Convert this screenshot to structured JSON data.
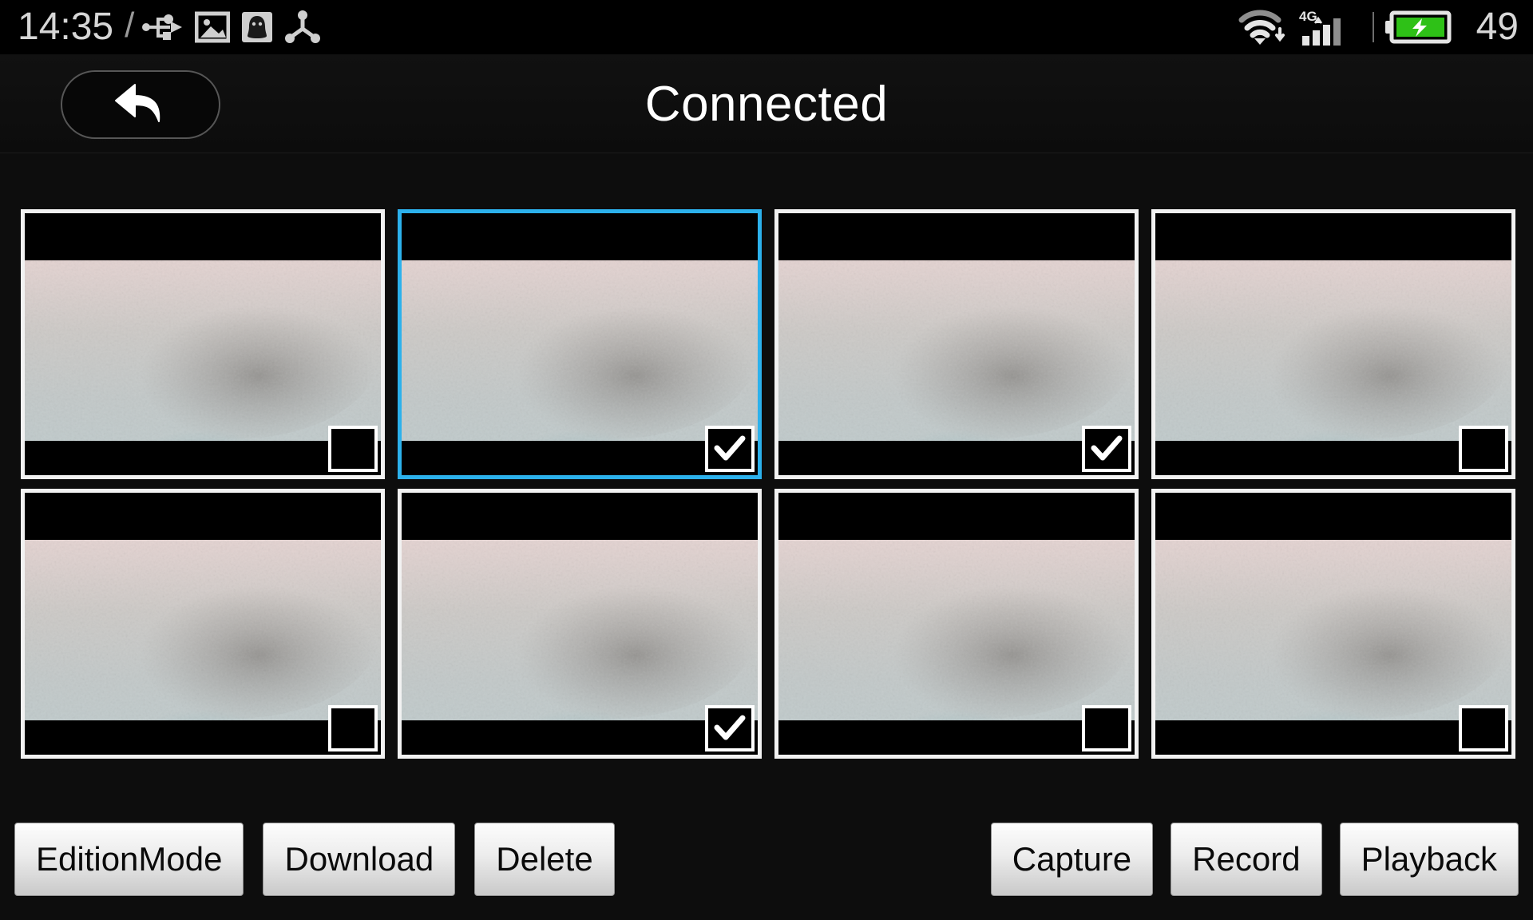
{
  "statusbar": {
    "clock": "14:35",
    "separator": "/",
    "left_icons": [
      "usb-icon",
      "gallery-icon",
      "qq-icon",
      "share-node-icon"
    ],
    "right_icons": [
      "wifi-download-icon",
      "signal-4g-icon",
      "battery-charging-icon"
    ],
    "network_label": "4G",
    "battery_percent": "49",
    "battery_color": "#2ec117"
  },
  "header": {
    "title": "Connected",
    "back_icon": "back-arrow-icon"
  },
  "grid": {
    "columns": 4,
    "rows": 2,
    "selected_index": 1,
    "accent_color": "#2cb1ec",
    "items": [
      {
        "index": 0,
        "checked": false,
        "selected": false
      },
      {
        "index": 1,
        "checked": true,
        "selected": true
      },
      {
        "index": 2,
        "checked": true,
        "selected": false
      },
      {
        "index": 3,
        "checked": false,
        "selected": false
      },
      {
        "index": 4,
        "checked": false,
        "selected": false
      },
      {
        "index": 5,
        "checked": true,
        "selected": false
      },
      {
        "index": 6,
        "checked": false,
        "selected": false
      },
      {
        "index": 7,
        "checked": false,
        "selected": false
      }
    ]
  },
  "toolbar": {
    "left_buttons": [
      {
        "label": "EditionMode",
        "name": "edition-mode-button"
      },
      {
        "label": "Download",
        "name": "download-button"
      },
      {
        "label": "Delete",
        "name": "delete-button"
      }
    ],
    "right_buttons": [
      {
        "label": "Capture",
        "name": "capture-button"
      },
      {
        "label": "Record",
        "name": "record-button"
      },
      {
        "label": "Playback",
        "name": "playback-button"
      }
    ]
  }
}
